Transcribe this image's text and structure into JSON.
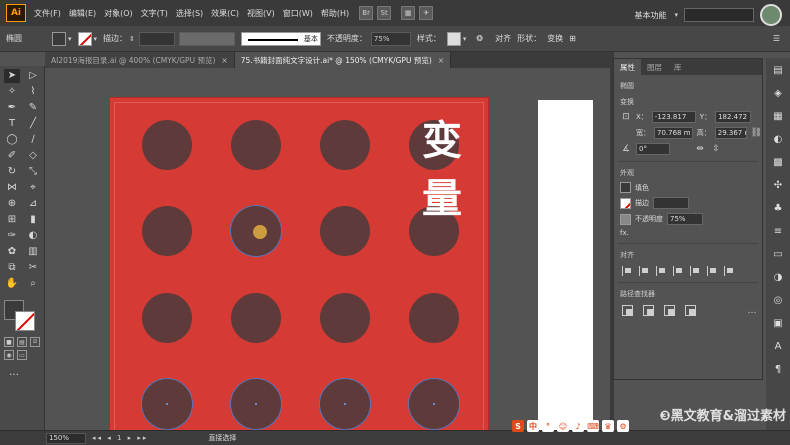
{
  "menubar": {
    "logo": "Ai",
    "items": [
      "文件(F)",
      "编辑(E)",
      "对象(O)",
      "文字(T)",
      "选择(S)",
      "效果(C)",
      "视图(V)",
      "窗口(W)",
      "帮助(H)"
    ],
    "workspace": "基本功能"
  },
  "control": {
    "selection_label": "椭圆",
    "stroke_label": "描边：",
    "stroke_style": "基本",
    "opacity_label": "不透明度：",
    "opacity_value": "75%",
    "style_label": "样式：",
    "align_label": "对齐",
    "shape_label": "形状：",
    "transform_label": "变换"
  },
  "tabs": [
    {
      "label": "AI2019海报目录.ai @ 400% (CMYK/GPU 预览)",
      "active": false
    },
    {
      "label": "75.书籍封面纯文字设计.ai* @ 150% (CMYK/GPU 预览)",
      "active": true
    }
  ],
  "colors": {
    "artboard": "#d63a35",
    "dot": "#5e3a3a",
    "selection": "#5576b8",
    "panel_bg": "#535353"
  },
  "canvas": {
    "vertical_text": [
      "变",
      "量"
    ]
  },
  "properties": {
    "tabs": [
      "属性",
      "图层",
      "库"
    ],
    "object_type": "椭圆",
    "transform_section": "变换",
    "x_label": "X：",
    "x_value": "-123.817",
    "y_label": "Y：",
    "y_value": "182.472",
    "w_label": "宽：",
    "w_value": "70.768 m",
    "h_label": "高：",
    "h_value": "29.367 m",
    "angle_value": "0°",
    "appearance_section": "外观",
    "fill_label": "填色",
    "stroke_label": "描边",
    "opacity_label": "不透明度",
    "opacity_value": "75%",
    "fx_label": "fx.",
    "align_section": "对齐",
    "pathfinder_section": "路径查找器"
  },
  "status": {
    "zoom": "150%",
    "tool": "直接选择"
  },
  "watermark": "❸黑文教育&溜过素材"
}
